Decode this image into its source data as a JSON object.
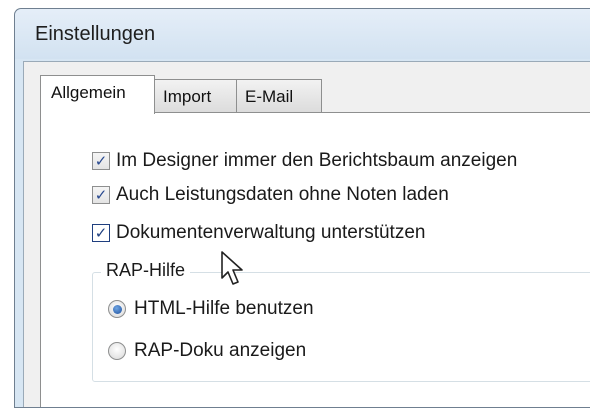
{
  "window": {
    "title": "Einstellungen"
  },
  "tabs": [
    {
      "label": "Allgemein",
      "active": true
    },
    {
      "label": "Import",
      "active": false
    },
    {
      "label": "E-Mail",
      "active": false
    }
  ],
  "checkboxes": [
    {
      "label": "Im Designer immer den Berichtsbaum anzeigen",
      "checked": true,
      "check_glyph": "✓"
    },
    {
      "label": "Auch Leistungsdaten ohne Noten laden",
      "checked": true,
      "check_glyph": "✓"
    },
    {
      "label": "Dokumentenverwaltung unterstützen",
      "checked": true,
      "check_glyph": "✓"
    }
  ],
  "group": {
    "label": "RAP-Hilfe",
    "options": [
      {
        "label": "HTML-Hilfe benutzen",
        "selected": true
      },
      {
        "label": "RAP-Doku anzeigen",
        "selected": false
      }
    ]
  },
  "cursor_icon": "arrow-pointer-icon",
  "colors": {
    "titlebar": "#d7e6f3",
    "check_mark": "#2a4a90",
    "radio_dot": "#1e4f9c"
  }
}
